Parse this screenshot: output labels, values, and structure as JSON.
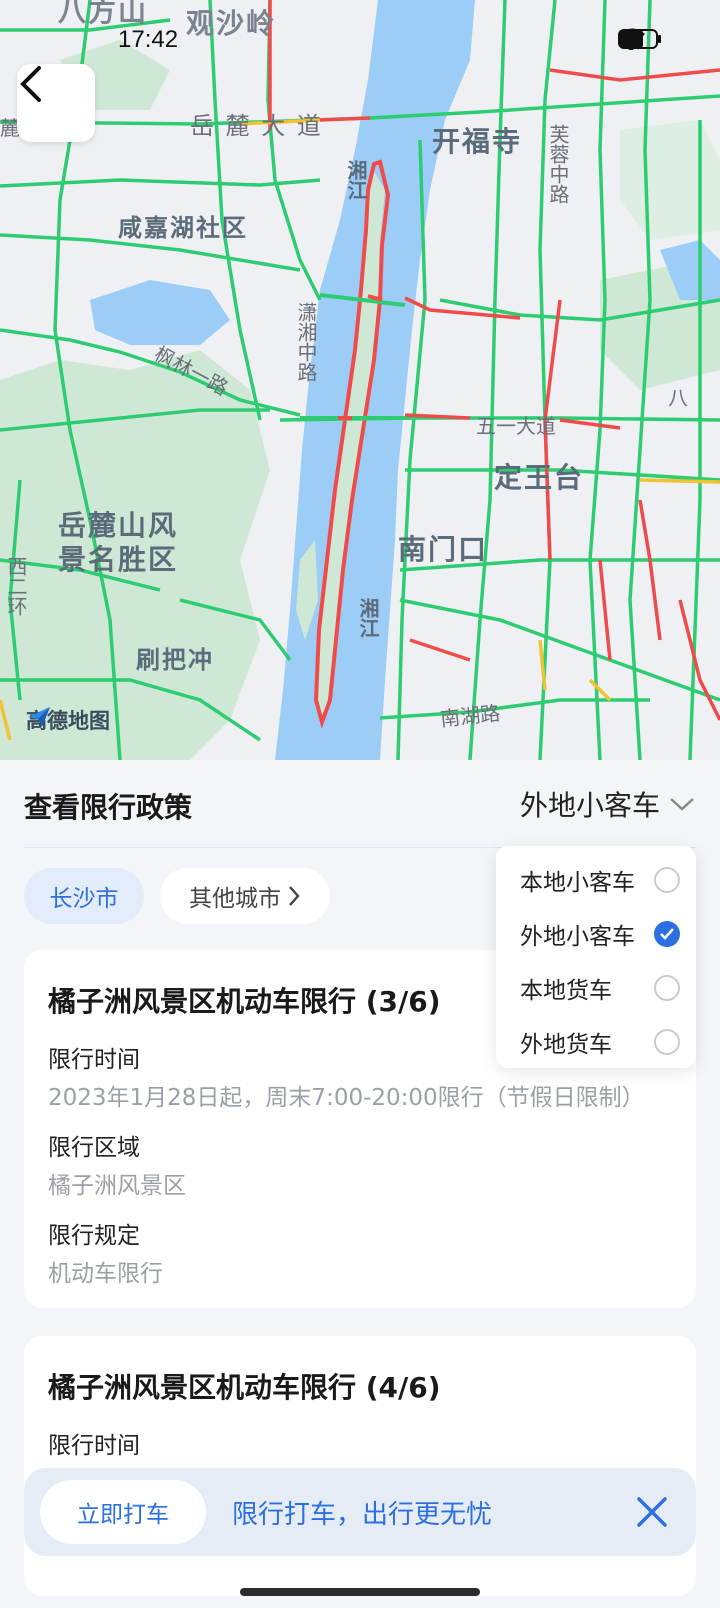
{
  "status_bar": {
    "time": "17:42"
  },
  "map": {
    "labels": {
      "bafang": "八方山",
      "guanshaling": "观沙岭",
      "yuelu_road": "岳  麓  大  道",
      "kaifusi": "开福寺",
      "furong_road": "芙蓉中路",
      "xianjiahu": "咸嘉湖社区",
      "xiangjiang_n": "湘江",
      "xiaoxiang_road": "潇湘中路",
      "fenglin_road": "枫林一路",
      "wuyi_road": "五一大道",
      "dingwangtai": "定王台",
      "yuelushan": "岳麓山风",
      "yuelushan2": "景名胜区",
      "nanmenkou": "南门口",
      "xiangjiang_s": "湘江",
      "shuabachong": "刷把冲",
      "nanhu_road": "南湖路",
      "ba": "八",
      "xi": "西二环",
      "lu": "麓"
    },
    "logo_text": "高德地图"
  },
  "panel": {
    "title": "查看限行政策",
    "selected_vehicle": "外地小客车",
    "chips": {
      "current_city": "长沙市",
      "other_cities": "其他城市"
    },
    "dropdown": [
      {
        "label": "本地小客车",
        "checked": false
      },
      {
        "label": "外地小客车",
        "checked": true
      },
      {
        "label": "本地货车",
        "checked": false
      },
      {
        "label": "外地货车",
        "checked": false
      }
    ],
    "cards": [
      {
        "title": "橘子洲风景区机动车限行 (3/6)",
        "time_label": "限行时间",
        "time_value": "2023年1月28日起，周末7:00-20:00限行（节假日限制）",
        "area_label": "限行区域",
        "area_value": "橘子洲风景区",
        "rule_label": "限行规定",
        "rule_value": "机动车限行"
      },
      {
        "title": "橘子洲风景区机动车限行 (4/6)",
        "time_label": "限行时间"
      }
    ]
  },
  "promo": {
    "button": "立即打车",
    "text": "限行打车，出行更无忧"
  },
  "colors": {
    "accent": "#2b6fe0",
    "road_green": "#2ecc71",
    "restriction_red": "#ef4b4b",
    "water": "#9ccdf7",
    "park": "#cfe8d6"
  }
}
